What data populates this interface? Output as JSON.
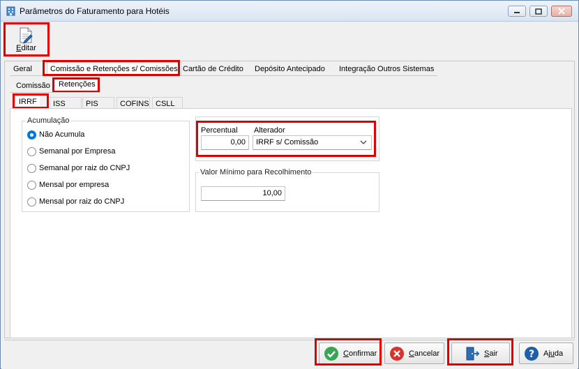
{
  "window": {
    "title": "Parâmetros do Faturamento para Hotéis"
  },
  "toolbar": {
    "edit_label_prefix": "",
    "edit_label_u": "E",
    "edit_label_rest": "ditar"
  },
  "main_tabs": [
    {
      "label": "Geral"
    },
    {
      "label": "Comissão e Retenções s/ Comissões"
    },
    {
      "label": "Cartão de Crédito"
    },
    {
      "label": "Depósito Antecipado"
    },
    {
      "label": "Integração Outros Sistemas"
    }
  ],
  "sub_tabs": [
    {
      "label": "Comissão"
    },
    {
      "label": "Retenções"
    }
  ],
  "tax_tabs": [
    {
      "label": "IRRF"
    },
    {
      "label": "ISS"
    },
    {
      "label": "PIS"
    },
    {
      "label": "COFINS"
    },
    {
      "label": "CSLL"
    }
  ],
  "acumulacao": {
    "title": "Acumulação",
    "options": [
      {
        "label": "Não Acumula",
        "checked": true
      },
      {
        "label": "Semanal por Empresa",
        "checked": false
      },
      {
        "label": "Semanal por raiz do CNPJ",
        "checked": false
      },
      {
        "label": "Mensal por empresa",
        "checked": false
      },
      {
        "label": "Mensal por raiz do CNPJ",
        "checked": false
      }
    ]
  },
  "percentual": {
    "label": "Percentual",
    "value": "0,00"
  },
  "alterador": {
    "label": "Alterador",
    "value": "IRRF s/ Comissão"
  },
  "valor_minimo": {
    "title": "Valor Mínimo para Recolhimento",
    "value": "10,00"
  },
  "footer": {
    "confirm": {
      "u": "C",
      "rest": "onfirmar"
    },
    "cancel": {
      "u": "C",
      "rest": "ancelar"
    },
    "exit": {
      "u": "S",
      "rest": "air"
    },
    "help": {
      "pre": "Aj",
      "u": "u",
      "rest": "da"
    }
  },
  "colors": {
    "highlight": "#e00000",
    "accent": "#0078d7",
    "confirm_green": "#3aa655",
    "cancel_red": "#d9342b",
    "help_blue": "#1e5fa8"
  }
}
